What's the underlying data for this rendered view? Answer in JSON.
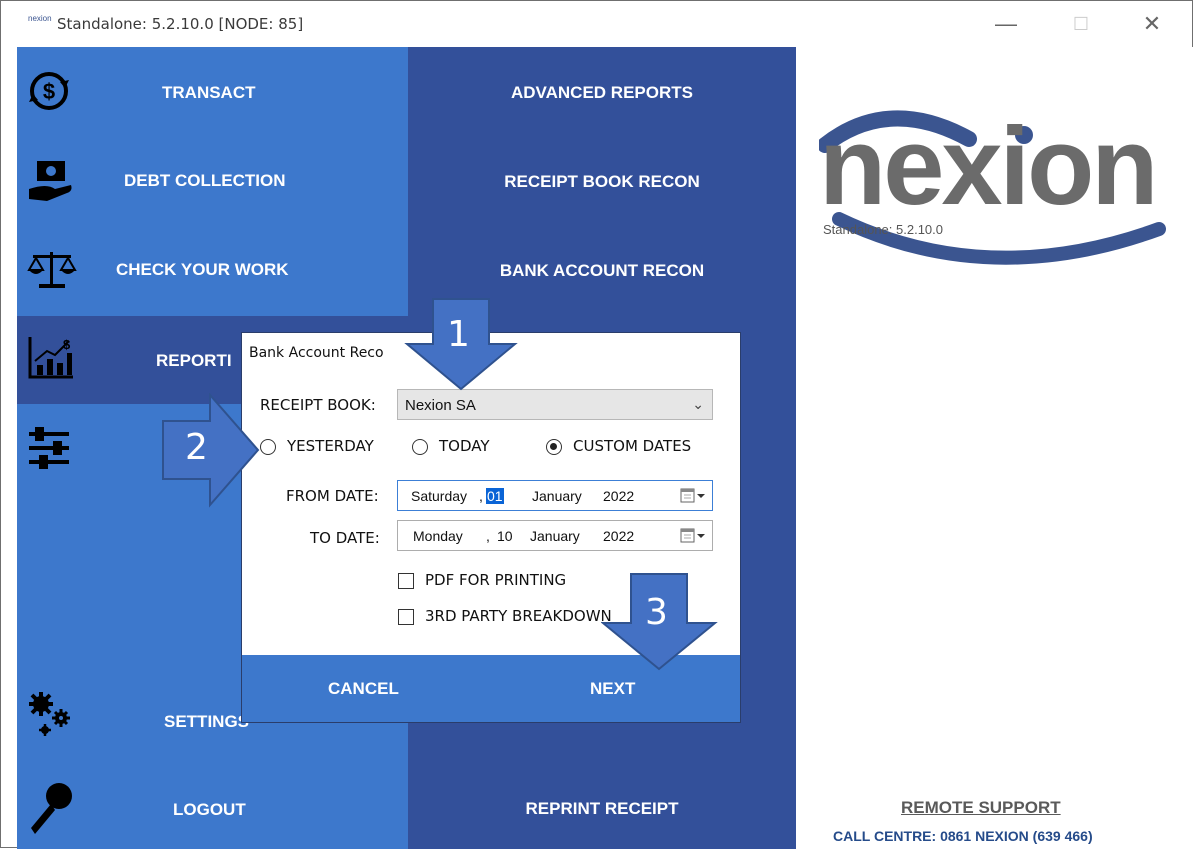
{
  "window": {
    "icon_text": "nexion",
    "title": "Standalone: 5.2.10.0 [NODE: 85]",
    "minimize": "—",
    "maximize": "☐",
    "close": "✕"
  },
  "left_menu": [
    {
      "label": "TRANSACT",
      "icon": "dollar-refresh-icon"
    },
    {
      "label": "DEBT COLLECTION",
      "icon": "hand-money-icon"
    },
    {
      "label": "CHECK YOUR WORK",
      "icon": "scales-icon"
    },
    {
      "label": "REPORTI",
      "icon": "chart-dollar-icon",
      "active": true
    },
    {
      "label": "",
      "icon": "sliders-icon"
    },
    {
      "label": "SETTINGS",
      "icon": "gears-icon"
    },
    {
      "label": "LOGOUT",
      "icon": "key-icon"
    }
  ],
  "mid_menu": [
    {
      "label": "ADVANCED REPORTS"
    },
    {
      "label": "RECEIPT BOOK RECON"
    },
    {
      "label": "BANK ACCOUNT RECON"
    },
    {
      "label": "REPRINT RECEIPT"
    }
  ],
  "brand": {
    "logo_text": "nexion",
    "version": "Standalone: 5.2.10.0",
    "remote_support": "REMOTE SUPPORT",
    "call_centre": "CALL CENTRE: 0861 NEXION (639 466)",
    "colors": {
      "grey": "#6b6b6b",
      "arc": "#3b5590"
    }
  },
  "dialog": {
    "title": "Bank Account Reco",
    "receipt_book_label": "RECEIPT BOOK:",
    "receipt_book_value": "Nexion SA",
    "radio_yesterday": "YESTERDAY",
    "radio_today": "TODAY",
    "radio_custom": "CUSTOM DATES",
    "selected_radio": "CUSTOM DATES",
    "from_label": "FROM DATE:",
    "from_date": {
      "weekday": "Saturday",
      "sep": ",",
      "day": "01",
      "month": "January",
      "year": "2022"
    },
    "to_label": "TO DATE:",
    "to_date": {
      "weekday": "Monday",
      "sep": ",",
      "day": "10",
      "month": "January",
      "year": "2022"
    },
    "pdf_printing": "PDF FOR PRINTING",
    "third_party": "3RD PARTY BREAKDOWN",
    "cancel": "CANCEL",
    "next": "NEXT"
  },
  "annotations": [
    "1",
    "2",
    "3"
  ],
  "colors": {
    "menu_light": "#3d78cc",
    "menu_dark": "#33509a",
    "arrow_fill": "#4471c4",
    "arrow_stroke": "#2f528f"
  }
}
